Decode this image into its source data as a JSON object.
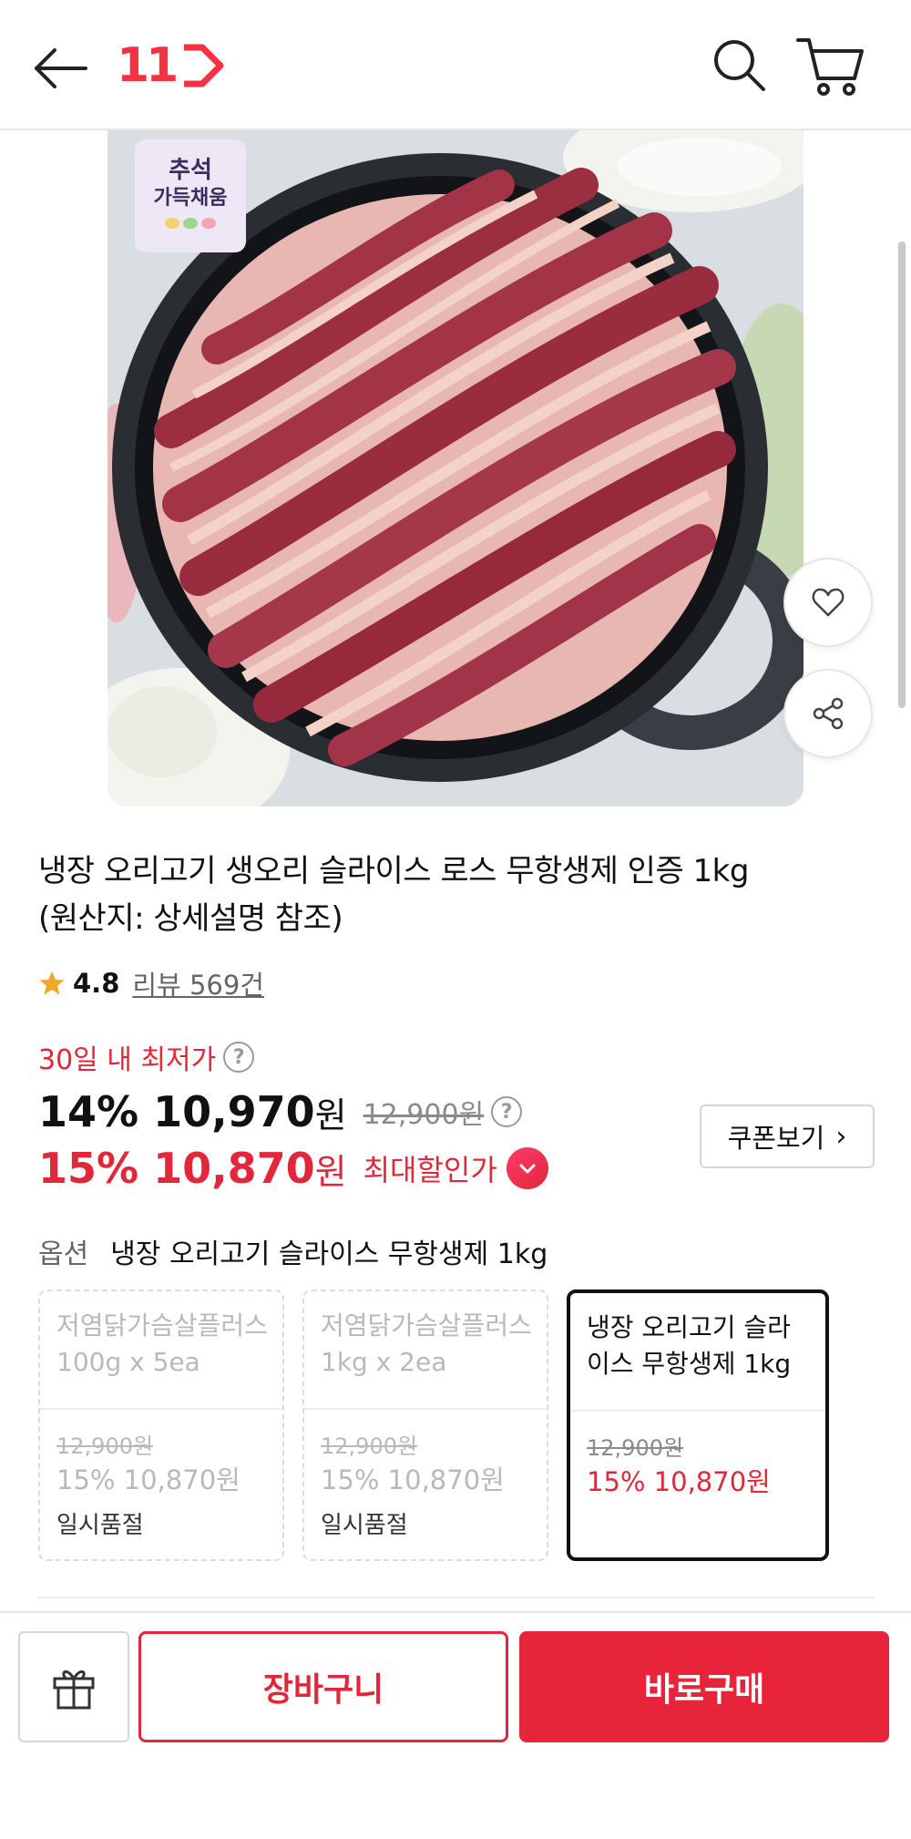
{
  "header": {
    "logo_text": "11",
    "back_icon": "arrow-left-icon",
    "search_icon": "search-icon",
    "cart_icon": "cart-icon"
  },
  "product": {
    "badge_line1": "추석",
    "badge_line2": "가득채움",
    "title_line1": "냉장 오리고기 생오리 슬라이스 로스 무항생제 인증 1kg",
    "title_line2": "(원산지: 상세설명 참조)",
    "rating": "4.8",
    "review_text": "리뷰 569건"
  },
  "price": {
    "lowest_label": "30일 내 최저가",
    "discount1": "14%",
    "price1": "10,970",
    "won": "원",
    "original_price": "12,900원",
    "discount2": "15%",
    "price2": "10,870",
    "max_label": "최대할인가",
    "coupon_label": "쿠폰보기"
  },
  "options": {
    "label": "옵션",
    "selected_value": "냉장 오리고기 슬라이스 무항생제 1kg",
    "cards": [
      {
        "name": "저염닭가슴살플러스 100g x 5ea",
        "original": "12,900원",
        "price": "15% 10,870원",
        "status": "일시품절"
      },
      {
        "name": "저염닭가슴살플러스 1kg x 2ea",
        "original": "12,900원",
        "price": "15% 10,870원",
        "status": "일시품절"
      },
      {
        "name": "냉장 오리고기 슬라이스 무항생제 1kg",
        "original": "12,900원",
        "price": "15% 10,870원",
        "status": ""
      }
    ]
  },
  "bottom": {
    "cart_label": "장바구니",
    "buy_label": "바로구매"
  },
  "colors": {
    "accent": "#e0283a",
    "buy_button": "#e8243a",
    "logo": "#f43142"
  }
}
